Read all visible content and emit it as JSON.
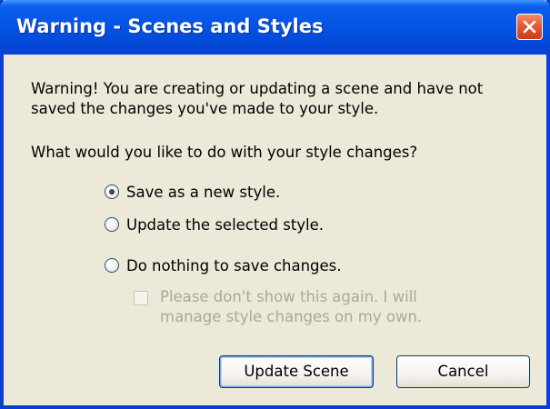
{
  "window": {
    "title": "Warning - Scenes and Styles",
    "close_icon": "close-icon"
  },
  "message": {
    "line1": "Warning! You are creating or updating a scene and have not",
    "line2": "saved the changes you've made to your style.",
    "question": "What would you like to do with your style changes?"
  },
  "options": [
    {
      "label": "Save as a new style.",
      "selected": true
    },
    {
      "label": "Update the selected style.",
      "selected": false
    },
    {
      "label": "Do nothing to save changes.",
      "selected": false
    }
  ],
  "dont_show": {
    "line1": "Please don't show this again.  I will",
    "line2": "manage style changes on my own.",
    "checked": false,
    "enabled": false
  },
  "buttons": {
    "update_scene": "Update Scene",
    "cancel": "Cancel"
  },
  "colors": {
    "titlebar": "#0553e4",
    "dialog_bg": "#ece9d8",
    "close_button": "#e35b33",
    "disabled_text": "#aca899"
  }
}
